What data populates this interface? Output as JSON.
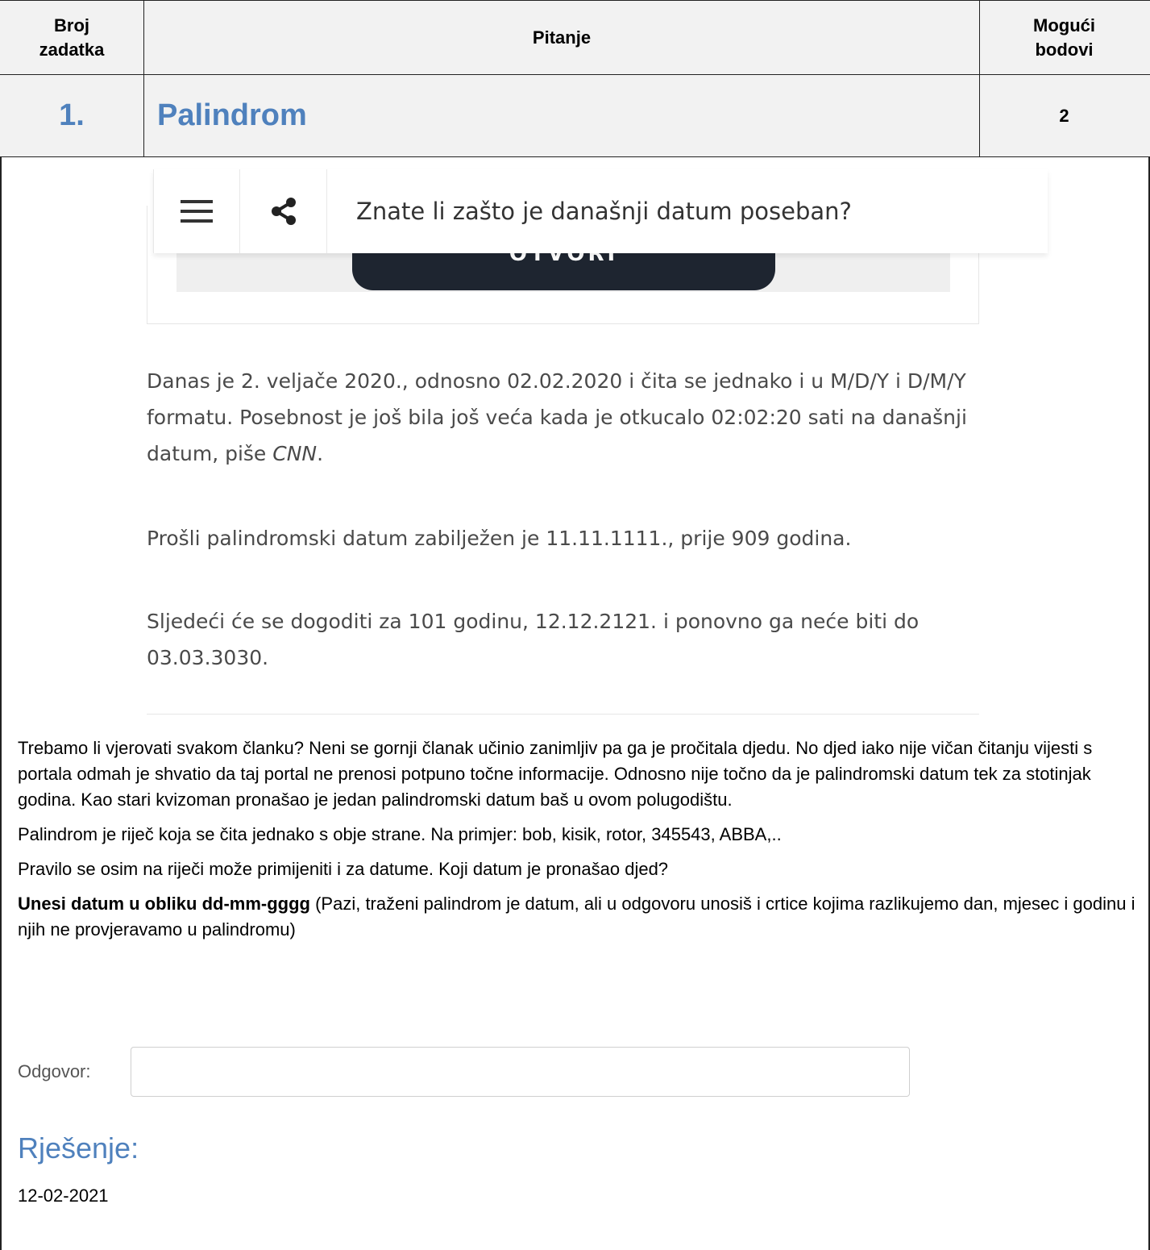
{
  "table": {
    "header": {
      "col1": "Broj zadatka",
      "col2": "Pitanje",
      "col3": "Mogući bodovi"
    },
    "task": {
      "number": "1.",
      "title": "Palindrom",
      "points": "2"
    }
  },
  "article": {
    "nav_title": "Znate li zašto je današnji datum poseban?",
    "button_label": "OTVORI",
    "paragraph1_a": "Danas je 2. veljače 2020., odnosno 02.02.2020 i čita se jednako i u M/D/Y i D/M/Y formatu. Posebnost je još bila još veća kada je otkucalo 02:02:20 sati na današnji datum, piše ",
    "paragraph1_source": "CNN",
    "paragraph1_b": ".",
    "paragraph2": "Prošli palindromski datum zabilježen je 11.11.1111., prije 909 godina.",
    "paragraph3": "Sljedeći će se dogoditi za 101 godinu, 12.12.2121. i ponovno ga neće biti do 03.03.3030."
  },
  "body": {
    "intro": "Trebamo li vjerovati svakom članku? Neni se gornji članak učinio zanimljiv pa ga je pročitala djedu. No djed iako nije vičan čitanju vijesti s portala odmah je shvatio da taj portal ne prenosi potpuno točne informacije. Odnosno nije točno da je palindromski datum tek za stotinjak godina. Kao stari kvizoman pronašao je jedan palindromski datum baš u ovom polugodištu.",
    "definition": "Palindrom je riječ koja se čita jednako s obje strane. Na primjer: bob, kisik, rotor, 345543, ABBA,..",
    "question": "Pravilo se osim na riječi može primijeniti i za datume. Koji datum je pronašao djed?",
    "instruction_bold": "Unesi datum u obliku dd-mm-gggg",
    "instruction_rest": " (Pazi, traženi palindrom je datum, ali u odgovoru unosiš i crtice kojima razlikujemo dan, mjesec i godinu i njih ne provjeravamo u palindromu)"
  },
  "answer": {
    "label": "Odgovor:",
    "value": ""
  },
  "solution": {
    "heading": "Rješenje:",
    "value": "12-02-2021"
  },
  "colors": {
    "accent": "#4f81bd",
    "header_bg": "#f2f2f2",
    "article_button": "#1e2530"
  },
  "icons": {
    "menu": "hamburger-menu-icon",
    "share": "share-icon"
  }
}
